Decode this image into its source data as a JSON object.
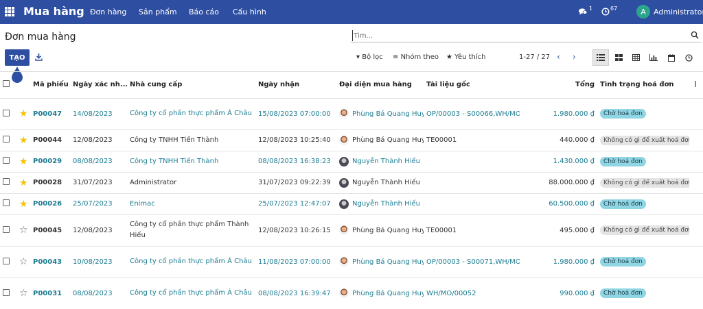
{
  "app": {
    "brand": "Mua hàng",
    "menu": [
      "Đơn hàng",
      "Sản phẩm",
      "Báo cáo",
      "Cấu hình"
    ],
    "messages_count": "1",
    "activities_count": "67",
    "user_initial": "A",
    "user_name": "Administrator"
  },
  "control": {
    "title": "Đơn mua hàng",
    "search_placeholder": "Tìm...",
    "create_label": "TẠO",
    "filters_label": "Bộ lọc",
    "group_by_label": "Nhóm theo",
    "favorites_label": "Yêu thích",
    "pager_text": "1-27 / 27",
    "views": [
      "list-icon",
      "kanban-icon",
      "pivot-icon",
      "graph-icon",
      "calendar-icon",
      "activity-icon"
    ]
  },
  "colors": {
    "brand": "#2e4fa1",
    "link": "#1b7c92",
    "star": "#f3c20c",
    "to_bill_badge": "#8fd5e3"
  },
  "table": {
    "columns": [
      "Mã phiếu",
      "Ngày xác nhận",
      "Nhà cung cấp",
      "Ngày nhận",
      "Đại diện mua hàng",
      "Tài liệu gốc",
      "Tổng",
      "Tình trạng hoá đơn"
    ],
    "column_display": [
      "Mã phiếu",
      "Ngày xác nh...",
      "Nhà cung cấp",
      "Ngày nhận",
      "Đại diện mua hàng",
      "Tài liệu gốc",
      "Tổng",
      "Tình trạng hoá đơn"
    ],
    "rows": [
      {
        "ref": "P00047",
        "starred": true,
        "confirm_date": "14/08/2023",
        "vendor": "Công ty cổ phần thực phẩm Á Châu",
        "receipt_date": "15/08/2023 07:00:00",
        "rep": "Phùng Bá Quang Huy",
        "rep_avatar": "a",
        "origin": "OP/00003 - S00066,WH/MO/000...",
        "total": "1.980.000 ₫",
        "status": "Chờ hoá đơn",
        "status_kind": "todo",
        "highlight": true,
        "tall": true
      },
      {
        "ref": "P00044",
        "starred": true,
        "confirm_date": "12/08/2023",
        "vendor": "Công ty TNHH Tiến Thành",
        "receipt_date": "12/08/2023 10:25:40",
        "rep": "Phùng Bá Quang Huy",
        "rep_avatar": "a",
        "origin": "TE00001",
        "total": "440.000 ₫",
        "status": "Không có gì để xuất hoá đơn",
        "status_kind": "none",
        "highlight": false,
        "tall": false
      },
      {
        "ref": "P00029",
        "starred": true,
        "confirm_date": "08/08/2023",
        "vendor": "Công ty TNHH Tiến Thành",
        "receipt_date": "08/08/2023 16:38:23",
        "rep": "Nguyễn Thành Hiếu",
        "rep_avatar": "b",
        "origin": "",
        "total": "1.430.000 ₫",
        "status": "Chờ hoá đơn",
        "status_kind": "todo",
        "highlight": true,
        "tall": false
      },
      {
        "ref": "P00028",
        "starred": true,
        "confirm_date": "31/07/2023",
        "vendor": "Administrator",
        "receipt_date": "31/07/2023 09:22:39",
        "rep": "Nguyễn Thành Hiếu",
        "rep_avatar": "b",
        "origin": "",
        "total": "88.000.000 ₫",
        "status": "Không có gì để xuất hoá đơn",
        "status_kind": "none",
        "highlight": false,
        "tall": false
      },
      {
        "ref": "P00026",
        "starred": true,
        "confirm_date": "25/07/2023",
        "vendor": "Enimac",
        "receipt_date": "25/07/2023 12:47:07",
        "rep": "Nguyễn Thành Hiếu",
        "rep_avatar": "b",
        "origin": "",
        "total": "60.500.000 ₫",
        "status": "Chờ hoá đơn",
        "status_kind": "todo",
        "highlight": true,
        "tall": false
      },
      {
        "ref": "P00045",
        "starred": false,
        "confirm_date": "12/08/2023",
        "vendor": "Công ty cổ phần thực phẩm Thành Hiếu",
        "receipt_date": "12/08/2023 10:26:15",
        "rep": "Phùng Bá Quang Huy",
        "rep_avatar": "a",
        "origin": "TE00001",
        "total": "495.000 ₫",
        "status": "Không có gì để xuất hoá đơn",
        "status_kind": "none",
        "highlight": false,
        "tall": true
      },
      {
        "ref": "P00043",
        "starred": false,
        "confirm_date": "10/08/2023",
        "vendor": "Công ty cổ phần thực phẩm Á Châu",
        "receipt_date": "11/08/2023 07:00:00",
        "rep": "Phùng Bá Quang Huy",
        "rep_avatar": "a",
        "origin": "OP/00003 - S00071,WH/MO/000...",
        "total": "1.980.000 ₫",
        "status": "Chờ hoá đơn",
        "status_kind": "todo",
        "highlight": true,
        "tall": true
      },
      {
        "ref": "P00031",
        "starred": false,
        "confirm_date": "08/08/2023",
        "vendor": "Công ty cổ phần thực phẩm Á Châu",
        "receipt_date": "08/08/2023 16:39:47",
        "rep": "Phùng Bá Quang Huy",
        "rep_avatar": "a",
        "origin": "WH/MO/00052",
        "total": "990.000 ₫",
        "status": "Chờ hoá đơn",
        "status_kind": "todo",
        "highlight": true,
        "tall": true
      }
    ]
  }
}
